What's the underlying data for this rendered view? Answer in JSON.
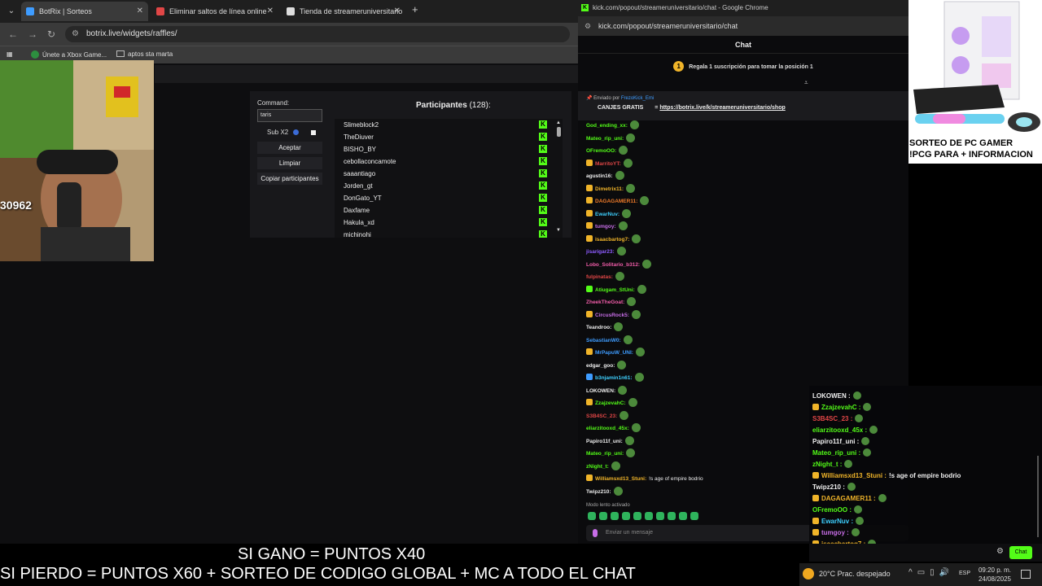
{
  "left_browser": {
    "tabs": [
      {
        "title": "BotRix | Sorteos",
        "icon_color": "#3e9cff"
      },
      {
        "title": "Eliminar saltos de línea online",
        "icon_color": "#e04646"
      },
      {
        "title": "Tienda de streameruniversitario",
        "icon_color": "#dddddd"
      }
    ],
    "url": "botrix.live/widgets/raffles/",
    "bookmarks": [
      "Únete a Xbox Game...",
      "aptos sta marta"
    ]
  },
  "raffle": {
    "command_label": "Command:",
    "command_value": "taris",
    "sub_label": "Sub X2",
    "buttons": [
      "Aceptar",
      "Limpiar",
      "Copiar participantes"
    ],
    "participants_label": "Participantes",
    "participants_count": "(128):",
    "participants": [
      "Slimeblock2",
      "TheDiuver",
      "BISHO_BY",
      "cebollaconcamote",
      "saaantiago",
      "Jorden_gt",
      "DonGato_YT",
      "Daxfame",
      "Hakula_xd",
      "michinohi"
    ]
  },
  "webcam": {
    "counter_text": "30962"
  },
  "right_browser": {
    "window_title": "kick.com/popout/streameruniversitario/chat - Google Chrome",
    "url": "kick.com/popout/streameruniversitario/chat",
    "chat_header": "Chat",
    "gift_number": "1",
    "gift_text": "Regala 1 suscripción para tomar la posición 1",
    "pinned_by_label": "Enviado por",
    "pinned_by_user": "FrezoKick_Emi",
    "pinned_title": "CANJES GRATIS",
    "pinned_sep": "=",
    "pinned_link": "https://botrix.live/k/streameruniversitario/shop",
    "slow_mode": "Modo lento activado",
    "input_placeholder": "Enviar un mensaje"
  },
  "chat_messages": [
    {
      "user": "God_ending_xx:",
      "color": "#53fc18",
      "text": ""
    },
    {
      "user": "Mateo_rip_uni:",
      "color": "#53fc18",
      "text": ""
    },
    {
      "user": "OFremoOO:",
      "color": "#53fc18",
      "text": ""
    },
    {
      "user": "MarritoYT:",
      "color": "#e04646",
      "text": ""
    },
    {
      "user": "agustin16:",
      "color": "#eeeeee",
      "text": ""
    },
    {
      "user": "Dimetrix11:",
      "color": "#f0b429",
      "text": ""
    },
    {
      "user": "DAGAGAMER11:",
      "color": "#f07b29",
      "text": ""
    },
    {
      "user": "EwarNuv:",
      "color": "#3ed0ff",
      "text": ""
    },
    {
      "user": "tumgoy:",
      "color": "#c86ee8",
      "text": ""
    },
    {
      "user": "isaacbartog7:",
      "color": "#f0b429",
      "text": ""
    },
    {
      "user": "jisarigar23:",
      "color": "#8e5cff",
      "text": ""
    },
    {
      "user": "Lobo_Solitario_b312:",
      "color": "#f05ca8",
      "text": ""
    },
    {
      "user": "fulpinatas:",
      "color": "#e04646",
      "text": ""
    },
    {
      "user": "Atiugam_StUni:",
      "color": "#53fc18",
      "text": ""
    },
    {
      "user": "ZheekTheGoat:",
      "color": "#f05ca8",
      "text": ""
    },
    {
      "user": "CircusRock5:",
      "color": "#c86ee8",
      "text": ""
    },
    {
      "user": "Teandroo:",
      "color": "#eeeeee",
      "text": ""
    },
    {
      "user": "SebastianW0:",
      "color": "#3e9cff",
      "text": ""
    },
    {
      "user": "MrPapuW_UNI:",
      "color": "#3e9cff",
      "text": ""
    },
    {
      "user": "edgar_goo:",
      "color": "#eeeeee",
      "text": ""
    },
    {
      "user": "b3njamin1n61:",
      "color": "#3ed0ff",
      "text": ""
    },
    {
      "user": "LOKOWEN:",
      "color": "#eeeeee",
      "text": ""
    },
    {
      "user": "ZzajzevahC:",
      "color": "#53fc18",
      "text": ""
    },
    {
      "user": "S3B4SC_23:",
      "color": "#e04646",
      "text": ""
    },
    {
      "user": "eliarzitooxd_45x:",
      "color": "#53fc18",
      "text": ""
    },
    {
      "user": "Papiro11f_uni:",
      "color": "#eeeeee",
      "text": ""
    },
    {
      "user": "Mateo_rip_uni:",
      "color": "#53fc18",
      "text": ""
    },
    {
      "user": "zNight_t:",
      "color": "#53fc18",
      "text": ""
    },
    {
      "user": "Williamsxd13_Stuni:",
      "color": "#f0b429",
      "text": "!s age of empire bodrio"
    },
    {
      "user": "Twipz210:",
      "color": "#eeeeee",
      "text": ""
    }
  ],
  "pc_ad": {
    "line1": "SORTEO DE PC GAMER",
    "line2": "!PCG PARA + INFORMACION"
  },
  "overlay_chat": [
    {
      "user": "LOKOWEN :",
      "color": "#eeeeee",
      "text": ""
    },
    {
      "user": "ZzajzevahC :",
      "color": "#53fc18",
      "text": ""
    },
    {
      "user": "S3B4SC_23 :",
      "color": "#e04646",
      "text": ""
    },
    {
      "user": "eliarzitooxd_45x :",
      "color": "#53fc18",
      "text": ""
    },
    {
      "user": "Papiro11f_uni :",
      "color": "#eeeeee",
      "text": ""
    },
    {
      "user": "Mateo_rip_uni :",
      "color": "#53fc18",
      "text": ""
    },
    {
      "user": "zNight_t :",
      "color": "#53fc18",
      "text": ""
    },
    {
      "user": "Williamsxd13_Stuni :",
      "color": "#f0b429",
      "text": "!s age of empire bodrio"
    },
    {
      "user": "Twipz210 :",
      "color": "#eeeeee",
      "text": ""
    },
    {
      "user": "DAGAGAMER11 :",
      "color": "#f0b429",
      "text": ""
    },
    {
      "user": "OFremoOO :",
      "color": "#53fc18",
      "text": ""
    },
    {
      "user": "EwarNuv :",
      "color": "#3ed0ff",
      "text": ""
    },
    {
      "user": "tumgoy :",
      "color": "#c86ee8",
      "text": ""
    },
    {
      "user": "isaacbartog7 :",
      "color": "#f0b429",
      "text": ""
    }
  ],
  "banner": {
    "line1": "SI GANO = PUNTOS X40",
    "line2": "SI PIERDO = PUNTOS X60 + SORTEO DE CODIGO GLOBAL + MC A TODO EL CHAT"
  },
  "mini_bar": {
    "chat_button": "Chat"
  },
  "taskbar": {
    "weather": "20°C  Prac. despejado",
    "lang": "ESP",
    "time": "09:20 p. m.",
    "date": "24/08/2025"
  }
}
